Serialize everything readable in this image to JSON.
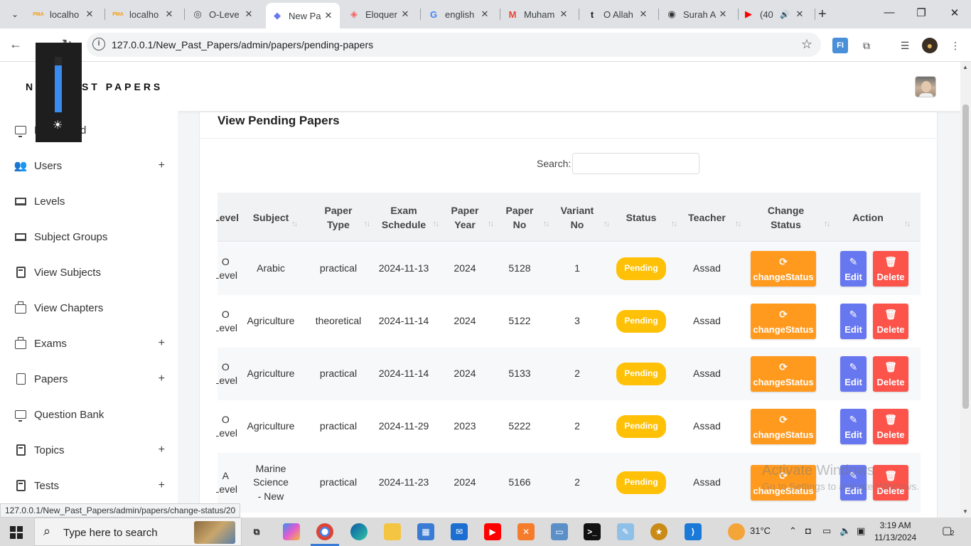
{
  "browser": {
    "tabs": [
      {
        "title": "localho",
        "favicon": "PMA",
        "favcolor": "#f89c0e"
      },
      {
        "title": "localho",
        "favicon": "PMA",
        "favcolor": "#f89c0e"
      },
      {
        "title": "O-Leve",
        "favicon": "◎",
        "favcolor": "#444"
      },
      {
        "title": "New Pa",
        "favicon": "◆",
        "favcolor": "#6777ef"
      },
      {
        "title": "Eloquer",
        "favicon": "◈",
        "favcolor": "#f4645f"
      },
      {
        "title": "english",
        "favicon": "G",
        "favcolor": "#4285f4"
      },
      {
        "title": "Muham",
        "favicon": "M",
        "favcolor": "#ea4335"
      },
      {
        "title": "O Allah",
        "favicon": "t",
        "favcolor": "#222"
      },
      {
        "title": "Surah A",
        "favicon": "◉",
        "favcolor": "#333"
      },
      {
        "title": "(40",
        "favicon": "▶",
        "favcolor": "#ff0000"
      }
    ],
    "url": "127.0.0.1/New_Past_Papers/admin/papers/pending-papers",
    "status_url": "127.0.0.1/New_Past_Papers/admin/papers/change-status/20"
  },
  "sidebar": {
    "brand": "NEW PAST PAPERS",
    "items": [
      {
        "label": "Dashboard",
        "icon": "monitor-icon",
        "plus": false
      },
      {
        "label": "Users",
        "icon": "users-icon",
        "plus": true
      },
      {
        "label": "Levels",
        "icon": "laptop-icon",
        "plus": false
      },
      {
        "label": "Subject Groups",
        "icon": "laptop-icon",
        "plus": false
      },
      {
        "label": "View Subjects",
        "icon": "book-icon",
        "plus": false
      },
      {
        "label": "View Chapters",
        "icon": "briefcase-icon",
        "plus": false
      },
      {
        "label": "Exams",
        "icon": "briefcase-icon",
        "plus": true
      },
      {
        "label": "Papers",
        "icon": "file-icon",
        "plus": true
      },
      {
        "label": "Question Bank",
        "icon": "monitor-icon",
        "plus": false
      },
      {
        "label": "Topics",
        "icon": "book-icon",
        "plus": true
      },
      {
        "label": "Tests",
        "icon": "book-icon",
        "plus": true
      }
    ],
    "plus_symbol": "+"
  },
  "overlay": {
    "brightness_level": 0.85,
    "icon": "sun-icon"
  },
  "page": {
    "title": "View Pending Papers",
    "search_label": "Search:",
    "columns": [
      "Level",
      "Subject",
      "Paper\nType",
      "Exam\nSchedule",
      "Paper\nYear",
      "Paper\nNo",
      "Variant\nNo",
      "Status",
      "Teacher",
      "Change\nStatus",
      "Action"
    ],
    "rows": [
      {
        "level": "O Level",
        "subject": "Arabic",
        "type": "practical",
        "schedule": "2024-11-13",
        "year": "2024",
        "no": "5128",
        "variant": "1",
        "status": "Pending",
        "teacher": "Assad"
      },
      {
        "level": "O Level",
        "subject": "Agriculture",
        "type": "theoretical",
        "schedule": "2024-11-14",
        "year": "2024",
        "no": "5122",
        "variant": "3",
        "status": "Pending",
        "teacher": "Assad"
      },
      {
        "level": "O Level",
        "subject": "Agriculture",
        "type": "practical",
        "schedule": "2024-11-14",
        "year": "2024",
        "no": "5133",
        "variant": "2",
        "status": "Pending",
        "teacher": "Assad"
      },
      {
        "level": "O Level",
        "subject": "Agriculture",
        "type": "practical",
        "schedule": "2024-11-29",
        "year": "2023",
        "no": "5222",
        "variant": "2",
        "status": "Pending",
        "teacher": "Assad"
      },
      {
        "level": "A Level",
        "subject": "Marine Science - New",
        "type": "practical",
        "schedule": "2024-11-23",
        "year": "2024",
        "no": "5166",
        "variant": "2",
        "status": "Pending",
        "teacher": "Assad"
      }
    ],
    "buttons": {
      "change": "changeStatus",
      "edit": "Edit",
      "delete": "Delete"
    }
  },
  "watermark": {
    "line1": "Activate Windows",
    "line2": "Go to Settings to activate Windows."
  },
  "taskbar": {
    "search_placeholder": "Type here to search",
    "weather": "31°C",
    "time": "3:19 AM",
    "date": "11/13/2024",
    "notifications": "2"
  }
}
